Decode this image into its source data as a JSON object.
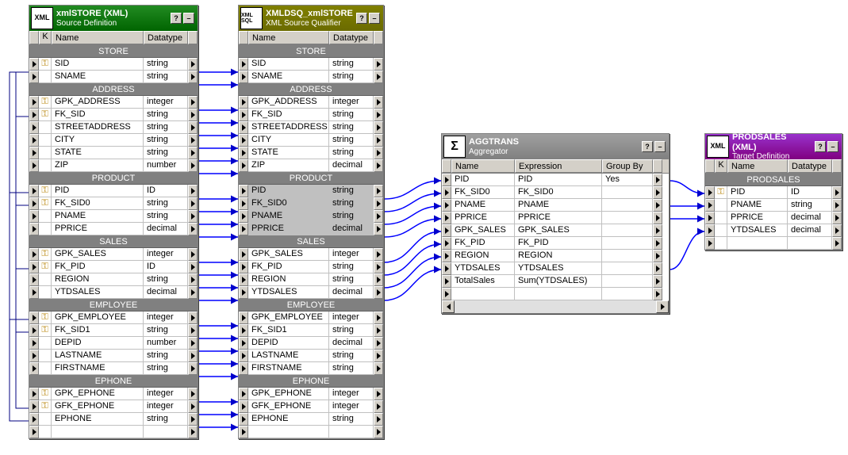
{
  "panel1": {
    "icon": "XML",
    "title": "xmlSTORE (XML)",
    "subtitle": "Source Definition",
    "headers": {
      "k": "K",
      "name": "Name",
      "datatype": "Datatype"
    },
    "groups": [
      {
        "label": "STORE",
        "rows": [
          {
            "key": true,
            "name": "SID",
            "type": "string"
          },
          {
            "key": false,
            "name": "SNAME",
            "type": "string"
          }
        ]
      },
      {
        "label": "ADDRESS",
        "rows": [
          {
            "key": true,
            "name": "GPK_ADDRESS",
            "type": "integer"
          },
          {
            "key": true,
            "name": "FK_SID",
            "type": "string"
          },
          {
            "key": false,
            "name": "STREETADDRESS",
            "type": "string"
          },
          {
            "key": false,
            "name": "CITY",
            "type": "string"
          },
          {
            "key": false,
            "name": "STATE",
            "type": "string"
          },
          {
            "key": false,
            "name": "ZIP",
            "type": "number"
          }
        ]
      },
      {
        "label": "PRODUCT",
        "rows": [
          {
            "key": true,
            "name": "PID",
            "type": "ID"
          },
          {
            "key": true,
            "name": "FK_SID0",
            "type": "string"
          },
          {
            "key": false,
            "name": "PNAME",
            "type": "string"
          },
          {
            "key": false,
            "name": "PPRICE",
            "type": "decimal"
          }
        ]
      },
      {
        "label": "SALES",
        "rows": [
          {
            "key": true,
            "name": "GPK_SALES",
            "type": "integer"
          },
          {
            "key": true,
            "name": "FK_PID",
            "type": "ID"
          },
          {
            "key": false,
            "name": "REGION",
            "type": "string"
          },
          {
            "key": false,
            "name": "YTDSALES",
            "type": "decimal"
          }
        ]
      },
      {
        "label": "EMPLOYEE",
        "rows": [
          {
            "key": true,
            "name": "GPK_EMPLOYEE",
            "type": "integer"
          },
          {
            "key": true,
            "name": "FK_SID1",
            "type": "string"
          },
          {
            "key": false,
            "name": "DEPID",
            "type": "number"
          },
          {
            "key": false,
            "name": "LASTNAME",
            "type": "string"
          },
          {
            "key": false,
            "name": "FIRSTNAME",
            "type": "string"
          }
        ]
      },
      {
        "label": "EPHONE",
        "rows": [
          {
            "key": true,
            "name": "GPK_EPHONE",
            "type": "integer"
          },
          {
            "key": true,
            "name": "GFK_EPHONE",
            "type": "integer"
          },
          {
            "key": false,
            "name": "EPHONE",
            "type": "string"
          }
        ]
      }
    ]
  },
  "panel2": {
    "icon": "XML SQL",
    "title": "XMLDSQ_xmlSTORE",
    "subtitle": "XML Source Qualifier",
    "headers": {
      "name": "Name",
      "datatype": "Datatype"
    },
    "shaded_group": "PRODUCT",
    "groups": [
      {
        "label": "STORE",
        "rows": [
          {
            "name": "SID",
            "type": "string"
          },
          {
            "name": "SNAME",
            "type": "string"
          }
        ]
      },
      {
        "label": "ADDRESS",
        "rows": [
          {
            "name": "GPK_ADDRESS",
            "type": "integer"
          },
          {
            "name": "FK_SID",
            "type": "string"
          },
          {
            "name": "STREETADDRESS",
            "type": "string"
          },
          {
            "name": "CITY",
            "type": "string"
          },
          {
            "name": "STATE",
            "type": "string"
          },
          {
            "name": "ZIP",
            "type": "decimal"
          }
        ]
      },
      {
        "label": "PRODUCT",
        "rows": [
          {
            "name": "PID",
            "type": "string"
          },
          {
            "name": "FK_SID0",
            "type": "string"
          },
          {
            "name": "PNAME",
            "type": "string"
          },
          {
            "name": "PPRICE",
            "type": "decimal"
          }
        ]
      },
      {
        "label": "SALES",
        "rows": [
          {
            "name": "GPK_SALES",
            "type": "integer"
          },
          {
            "name": "FK_PID",
            "type": "string"
          },
          {
            "name": "REGION",
            "type": "string"
          },
          {
            "name": "YTDSALES",
            "type": "decimal"
          }
        ]
      },
      {
        "label": "EMPLOYEE",
        "rows": [
          {
            "name": "GPK_EMPLOYEE",
            "type": "integer"
          },
          {
            "name": "FK_SID1",
            "type": "string"
          },
          {
            "name": "DEPID",
            "type": "decimal"
          },
          {
            "name": "LASTNAME",
            "type": "string"
          },
          {
            "name": "FIRSTNAME",
            "type": "string"
          }
        ]
      },
      {
        "label": "EPHONE",
        "rows": [
          {
            "name": "GPK_EPHONE",
            "type": "integer"
          },
          {
            "name": "GFK_EPHONE",
            "type": "integer"
          },
          {
            "name": "EPHONE",
            "type": "string"
          }
        ]
      }
    ]
  },
  "panel3": {
    "icon": "Σ",
    "title": "AGGTRANS",
    "subtitle": "Aggregator",
    "headers": {
      "name": "Name",
      "expr": "Expression",
      "gb": "Group By"
    },
    "rows": [
      {
        "name": "PID",
        "expr": "PID",
        "gb": "Yes"
      },
      {
        "name": "FK_SID0",
        "expr": "FK_SID0",
        "gb": ""
      },
      {
        "name": "PNAME",
        "expr": "PNAME",
        "gb": ""
      },
      {
        "name": "PPRICE",
        "expr": "PPRICE",
        "gb": ""
      },
      {
        "name": "GPK_SALES",
        "expr": "GPK_SALES",
        "gb": ""
      },
      {
        "name": "FK_PID",
        "expr": "FK_PID",
        "gb": ""
      },
      {
        "name": "REGION",
        "expr": "REGION",
        "gb": ""
      },
      {
        "name": "YTDSALES",
        "expr": "YTDSALES",
        "gb": ""
      },
      {
        "name": "TotalSales",
        "expr": "Sum(YTDSALES)",
        "gb": ""
      }
    ]
  },
  "panel4": {
    "icon": "XML",
    "title": "PRODSALES (XML)",
    "subtitle": "Target Definition",
    "headers": {
      "k": "K",
      "name": "Name",
      "datatype": "Datatype"
    },
    "groups": [
      {
        "label": "PRODSALES",
        "rows": [
          {
            "key": true,
            "name": "PID",
            "type": "ID"
          },
          {
            "key": false,
            "name": "PNAME",
            "type": "string"
          },
          {
            "key": false,
            "name": "PPRICE",
            "type": "decimal"
          },
          {
            "key": false,
            "name": "YTDSALES",
            "type": "decimal"
          }
        ]
      }
    ]
  },
  "controls": {
    "help": "?",
    "close": "×",
    "minus": "–"
  }
}
